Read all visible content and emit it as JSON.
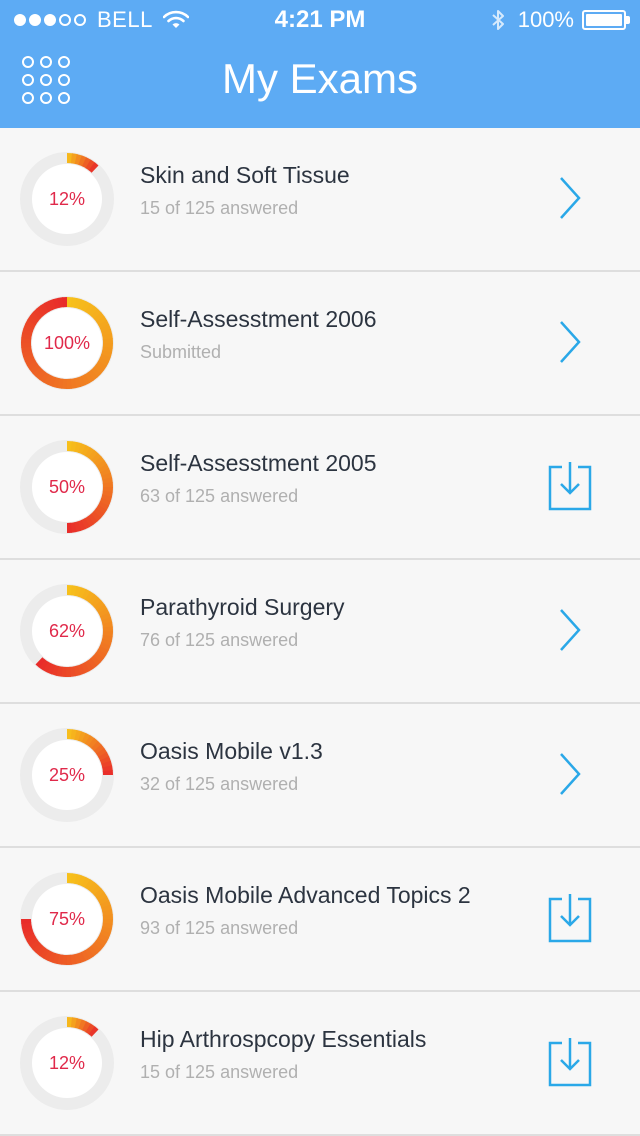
{
  "status_bar": {
    "carrier": "BELL",
    "time": "4:21 PM",
    "battery": "100%",
    "signal_bars_filled": 3,
    "signal_bars_total": 5
  },
  "header": {
    "title": "My Exams"
  },
  "colors": {
    "header_bg": "#5dabf4",
    "accent": "#2aa8e8",
    "ring_track": "#ececec",
    "ring_start": "#f7c21b",
    "ring_end": "#e82a2a",
    "percent_text": "#e0294a"
  },
  "exams": [
    {
      "title": "Skin and Soft Tissue",
      "subtitle": "15 of 125 answered",
      "percent_label": "12%",
      "progress": 0.12,
      "action": "chevron-right-icon"
    },
    {
      "title": "Self-Assesstment 2006",
      "subtitle": "Submitted",
      "percent_label": "100%",
      "progress": 1.0,
      "action": "chevron-right-icon"
    },
    {
      "title": "Self-Assesstment 2005",
      "subtitle": "63 of 125 answered",
      "percent_label": "50%",
      "progress": 0.5,
      "action": "download-icon"
    },
    {
      "title": "Parathyroid Surgery",
      "subtitle": "76 of 125 answered",
      "percent_label": "62%",
      "progress": 0.62,
      "action": "chevron-right-icon"
    },
    {
      "title": "Oasis Mobile v1.3",
      "subtitle": "32 of 125 answered",
      "percent_label": "25%",
      "progress": 0.25,
      "action": "chevron-right-icon"
    },
    {
      "title": "Oasis Mobile Advanced Topics 2",
      "subtitle": "93 of 125 answered",
      "percent_label": "75%",
      "progress": 0.75,
      "action": "download-icon"
    },
    {
      "title": "Hip Arthrospcopy Essentials",
      "subtitle": "15 of 125 answered",
      "percent_label": "12%",
      "progress": 0.12,
      "action": "download-icon"
    }
  ]
}
